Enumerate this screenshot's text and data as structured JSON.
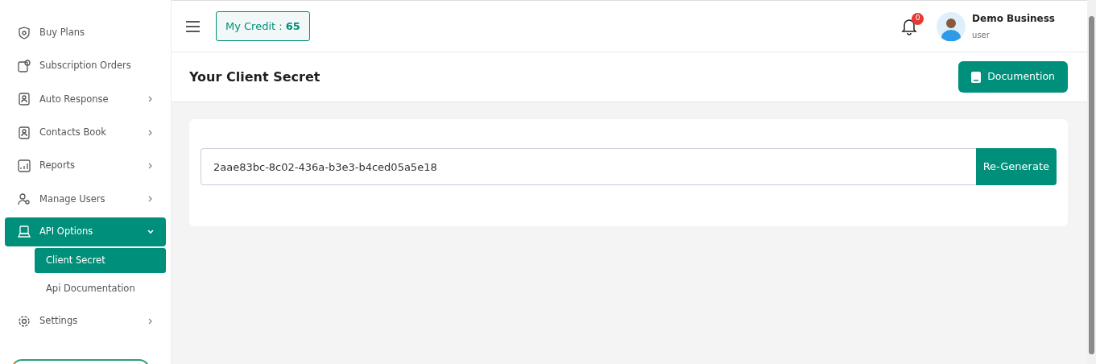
{
  "sidebar": {
    "items": [
      {
        "label": "Buy Plans",
        "has_submenu": false,
        "selected": false
      },
      {
        "label": "Subscription Orders",
        "has_submenu": false,
        "selected": false
      },
      {
        "label": "Auto Response",
        "has_submenu": true,
        "expanded": false,
        "selected": false
      },
      {
        "label": "Contacts Book",
        "has_submenu": true,
        "expanded": false,
        "selected": false
      },
      {
        "label": "Reports",
        "has_submenu": true,
        "expanded": false,
        "selected": false
      },
      {
        "label": "Manage Users",
        "has_submenu": true,
        "expanded": false,
        "selected": false
      },
      {
        "label": "API Options",
        "has_submenu": true,
        "expanded": true,
        "selected": true,
        "children": [
          {
            "label": "Client Secret",
            "selected": true
          },
          {
            "label": "Api Documentation",
            "selected": false
          }
        ]
      },
      {
        "label": "Settings",
        "has_submenu": true,
        "expanded": false,
        "selected": false
      }
    ]
  },
  "header": {
    "credit_label": "My Credit : ",
    "credit_value": "65",
    "notification_count": "0",
    "user_name": "Demo Business",
    "user_role": "user"
  },
  "page": {
    "title": "Your Client Secret",
    "doc_button": "Documention",
    "secret": "2aae83bc-8c02-436a-b3e3-b4ced05a5e18",
    "regenerate_button": "Re-Generate"
  }
}
